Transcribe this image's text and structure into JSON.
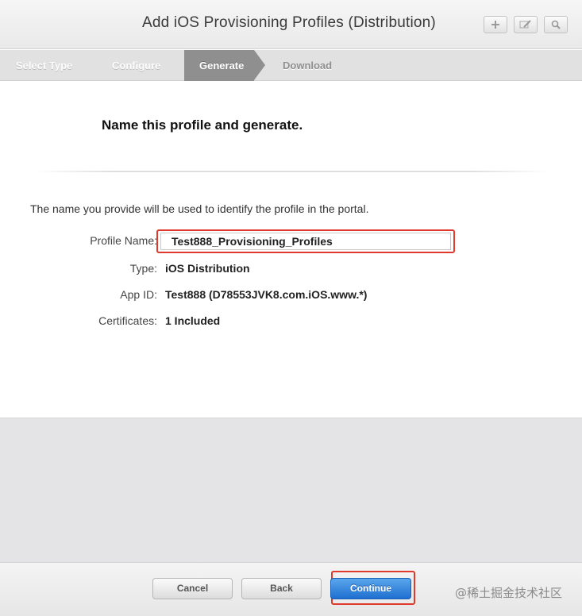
{
  "header": {
    "title": "Add iOS Provisioning Profiles (Distribution)",
    "tools": [
      {
        "icon": "plus-icon"
      },
      {
        "icon": "edit-icon"
      },
      {
        "icon": "search-icon"
      }
    ]
  },
  "steps": {
    "items": [
      "Select Type",
      "Configure",
      "Generate",
      "Download"
    ],
    "active": "Generate"
  },
  "main": {
    "heading": "Name this profile and generate.",
    "intro": "The name you provide will be used to identify the profile in the portal.",
    "profile_name_label": "Profile Name:",
    "profile_name_value": "Test888_Provisioning_Profiles",
    "type_label": "Type:",
    "type_value": "iOS Distribution",
    "app_id_label": "App ID:",
    "app_id_value": "Test888 (D78553JVK8.com.iOS.www.*)",
    "certificates_label": "Certificates:",
    "certificates_value": "1 Included"
  },
  "footer": {
    "cancel_label": "Cancel",
    "back_label": "Back",
    "continue_label": "Continue"
  },
  "watermark": "@稀土掘金技术社区",
  "colors": {
    "highlight": "#e03a2e",
    "primary_button": "#1f6fd0",
    "active_step": "#8f8f8f"
  }
}
